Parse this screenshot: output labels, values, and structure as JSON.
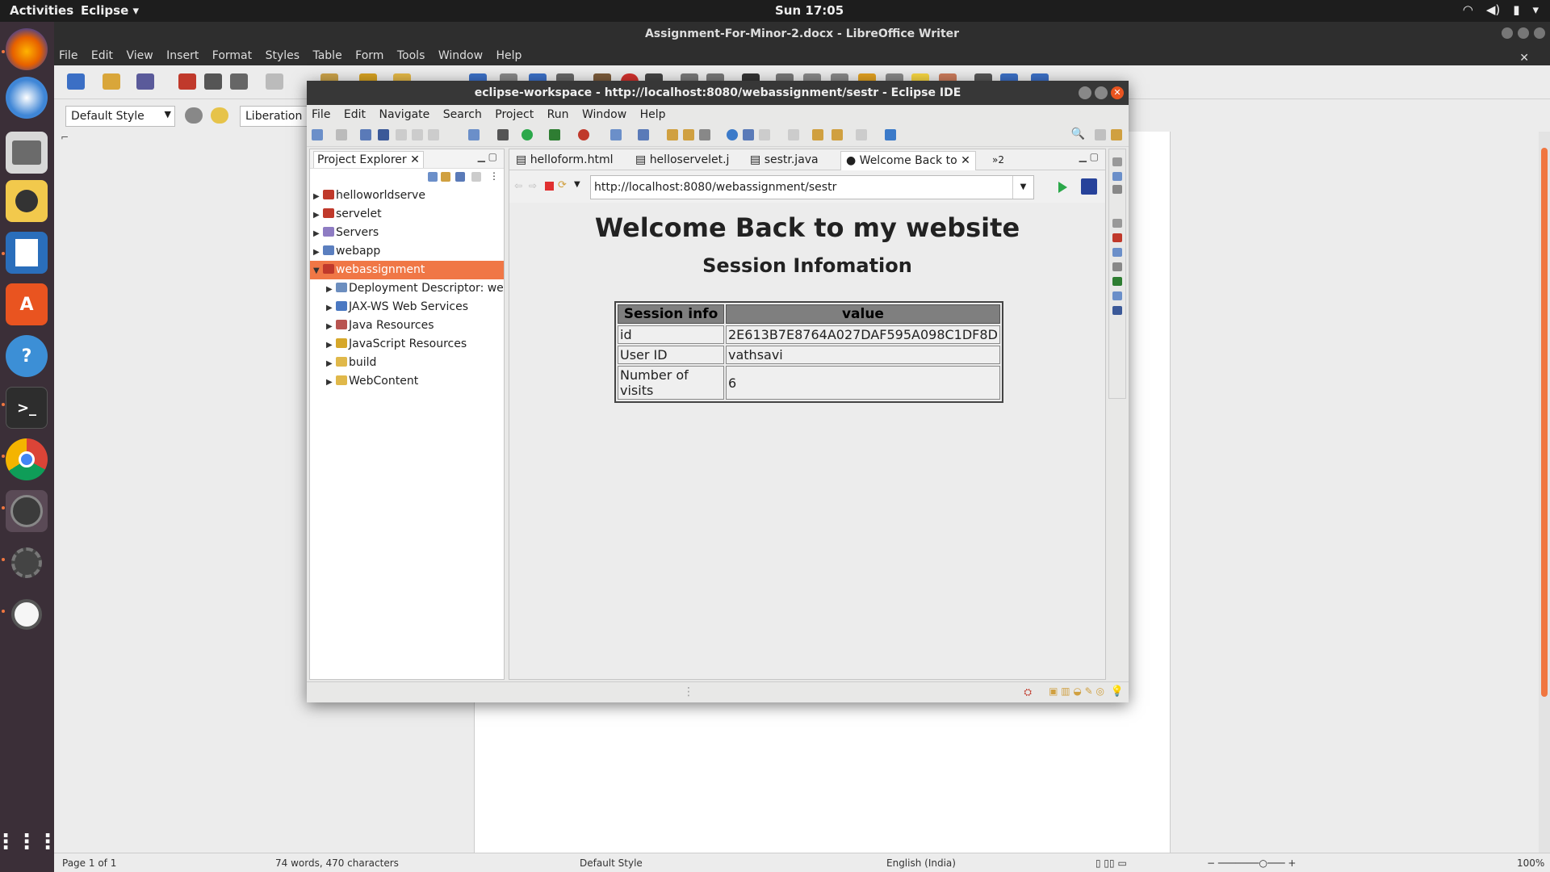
{
  "topbar": {
    "activities": "Activities",
    "app_menu": "Eclipse ▾",
    "clock": "Sun 17:05",
    "tray_icons": [
      "wifi-icon",
      "volume-icon",
      "battery-icon"
    ]
  },
  "dock": {
    "items": [
      "firefox",
      "thunderbird",
      "files",
      "rhythmbox",
      "libreoffice-writer",
      "software-center",
      "help",
      "terminal",
      "chrome",
      "eclipse-javaee",
      "settings",
      "software-updater",
      "show-applications"
    ]
  },
  "writer": {
    "title": "Assignment-For-Minor-2.docx - LibreOffice Writer",
    "menu": [
      "File",
      "Edit",
      "View",
      "Insert",
      "Format",
      "Styles",
      "Table",
      "Form",
      "Tools",
      "Window",
      "Help"
    ],
    "paragraph_style": "Default Style",
    "font_name": "Liberation",
    "status": {
      "page": "Page 1 of 1",
      "words": "74 words, 470 characters",
      "style": "Default Style",
      "language": "English (India)",
      "zoom": "100%"
    }
  },
  "eclipse": {
    "title": "eclipse-workspace - http://localhost:8080/webassignment/sestr - Eclipse IDE",
    "menu": [
      "File",
      "Edit",
      "Navigate",
      "Search",
      "Project",
      "Run",
      "Window",
      "Help"
    ],
    "explorer": {
      "title": "Project Explorer",
      "items": [
        {
          "label": "helloworldserve",
          "level": 0,
          "expanded": false,
          "selected": false,
          "color": "#c0392b"
        },
        {
          "label": "servelet",
          "level": 0,
          "expanded": false,
          "selected": false,
          "color": "#c0392b"
        },
        {
          "label": "Servers",
          "level": 0,
          "expanded": false,
          "selected": false,
          "color": "#8e7cc3"
        },
        {
          "label": "webapp",
          "level": 0,
          "expanded": false,
          "selected": false,
          "color": "#5b7fbf"
        },
        {
          "label": "webassignment",
          "level": 0,
          "expanded": true,
          "selected": true,
          "color": "#c0392b"
        },
        {
          "label": "Deployment Descriptor: web",
          "level": 1,
          "expanded": false,
          "selected": false,
          "color": "#6c8ebf"
        },
        {
          "label": "JAX-WS Web Services",
          "level": 1,
          "expanded": false,
          "selected": false,
          "color": "#4a78c2"
        },
        {
          "label": "Java Resources",
          "level": 1,
          "expanded": false,
          "selected": false,
          "color": "#b85450"
        },
        {
          "label": "JavaScript Resources",
          "level": 1,
          "expanded": false,
          "selected": false,
          "color": "#d6a72a"
        },
        {
          "label": "build",
          "level": 1,
          "expanded": false,
          "selected": false,
          "color": "#e0b84a"
        },
        {
          "label": "WebContent",
          "level": 1,
          "expanded": false,
          "selected": false,
          "color": "#e0b84a"
        }
      ]
    },
    "editor": {
      "tabs": [
        {
          "label": "helloform.html",
          "active": false
        },
        {
          "label": "helloservelet.j",
          "active": false
        },
        {
          "label": "sestr.java",
          "active": false
        },
        {
          "label": "Welcome Back to",
          "active": true
        }
      ],
      "overflow_tabs": "»2",
      "url": "http://localhost:8080/webassignment/sestr",
      "page": {
        "heading": "Welcome Back to my website",
        "subheading": "Session Infomation",
        "table": {
          "headers": [
            "Session info",
            "value"
          ],
          "rows": [
            [
              "id",
              "2E613B7E8764A027DAF595A098C1DF8D"
            ],
            [
              "User ID",
              "vathsavi"
            ],
            [
              "Number of visits",
              "6"
            ]
          ]
        }
      }
    }
  }
}
